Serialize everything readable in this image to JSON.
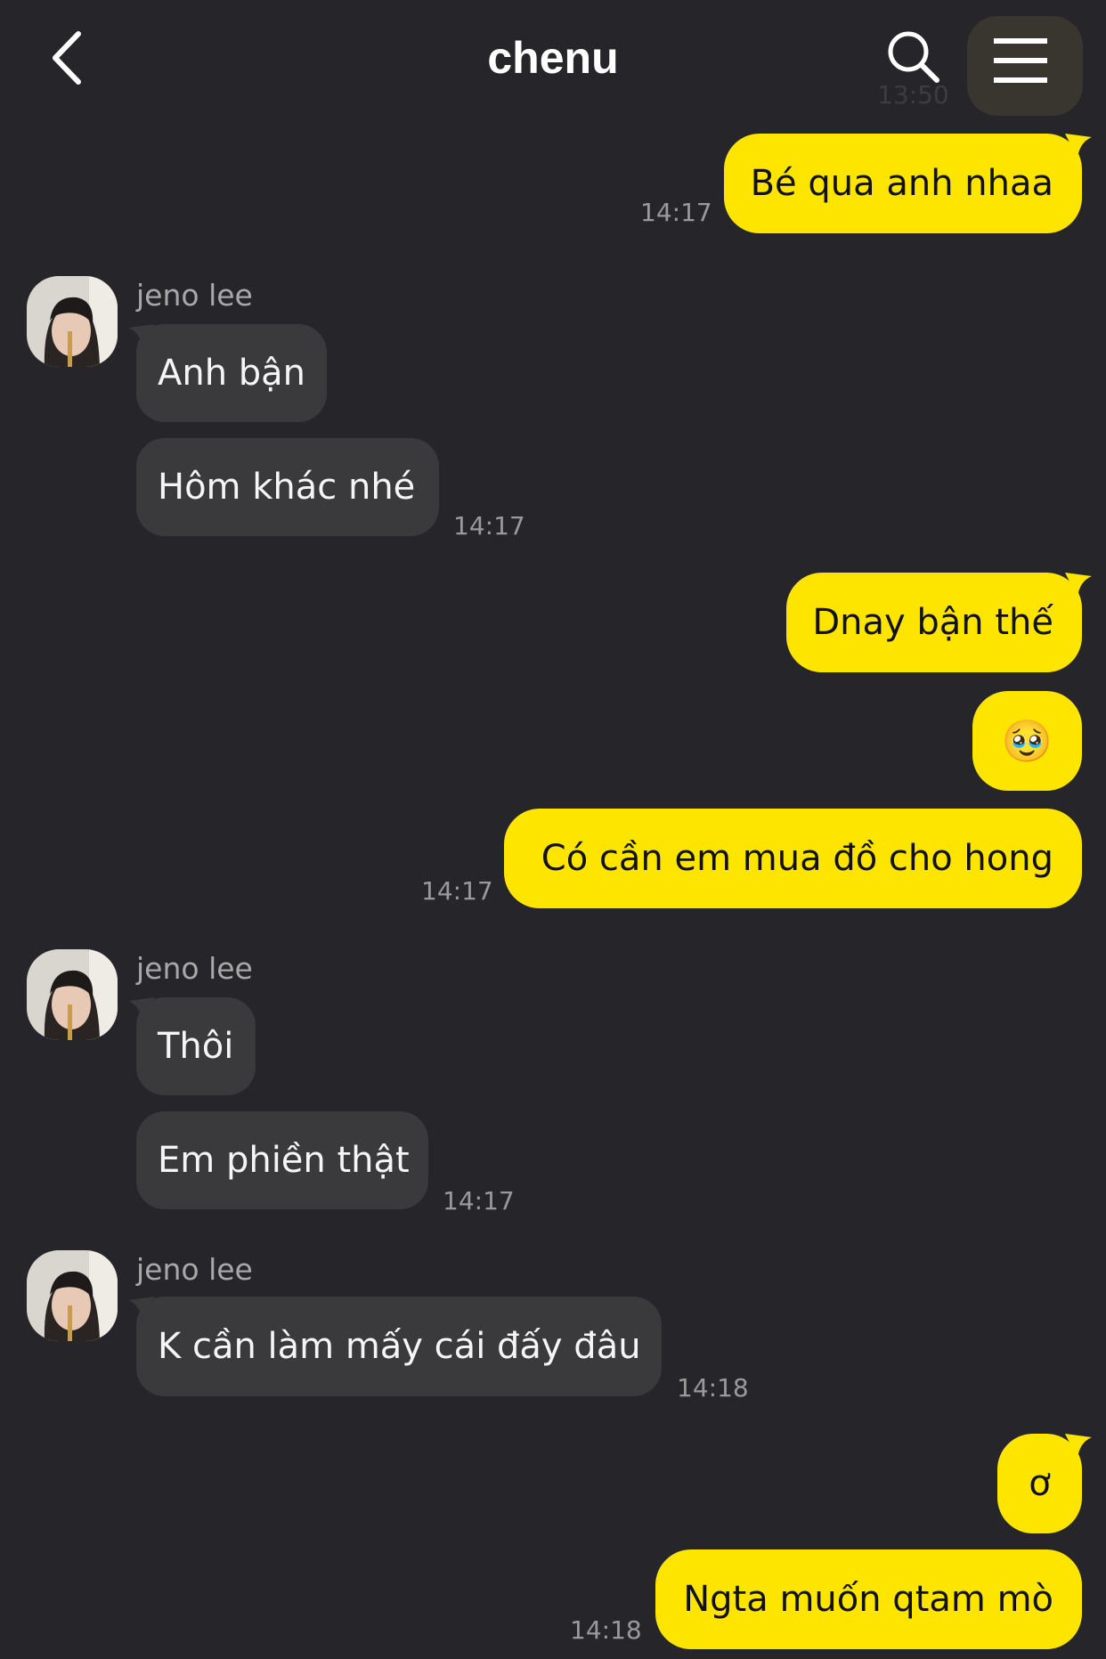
{
  "header": {
    "title": "chenu",
    "ghost_time": "13:50"
  },
  "contact_name": "jeno lee",
  "messages": {
    "m1": {
      "text": "Bé qua anh nhaa",
      "time": "14:17"
    },
    "m2": {
      "text": "Anh bận"
    },
    "m3": {
      "text": "Hôm khác nhé",
      "time": "14:17"
    },
    "m4": {
      "text": "Dnay bận thế"
    },
    "m5": {
      "text": "🥹"
    },
    "m6": {
      "text": "Có cần em mua đồ cho hong",
      "time": "14:17"
    },
    "m7": {
      "text": "Thôi"
    },
    "m8": {
      "text": "Em phiền thật",
      "time": "14:17"
    },
    "m9": {
      "text": "K cần làm mấy cái đấy đâu",
      "time": "14:18"
    },
    "m10": {
      "text": "ơ"
    },
    "m11": {
      "text": "Ngta muốn qtam mò",
      "time": "14:18"
    }
  },
  "colors": {
    "background": "#26262a",
    "outgoing_bubble": "#fee500",
    "incoming_bubble": "#3a3a3d"
  }
}
